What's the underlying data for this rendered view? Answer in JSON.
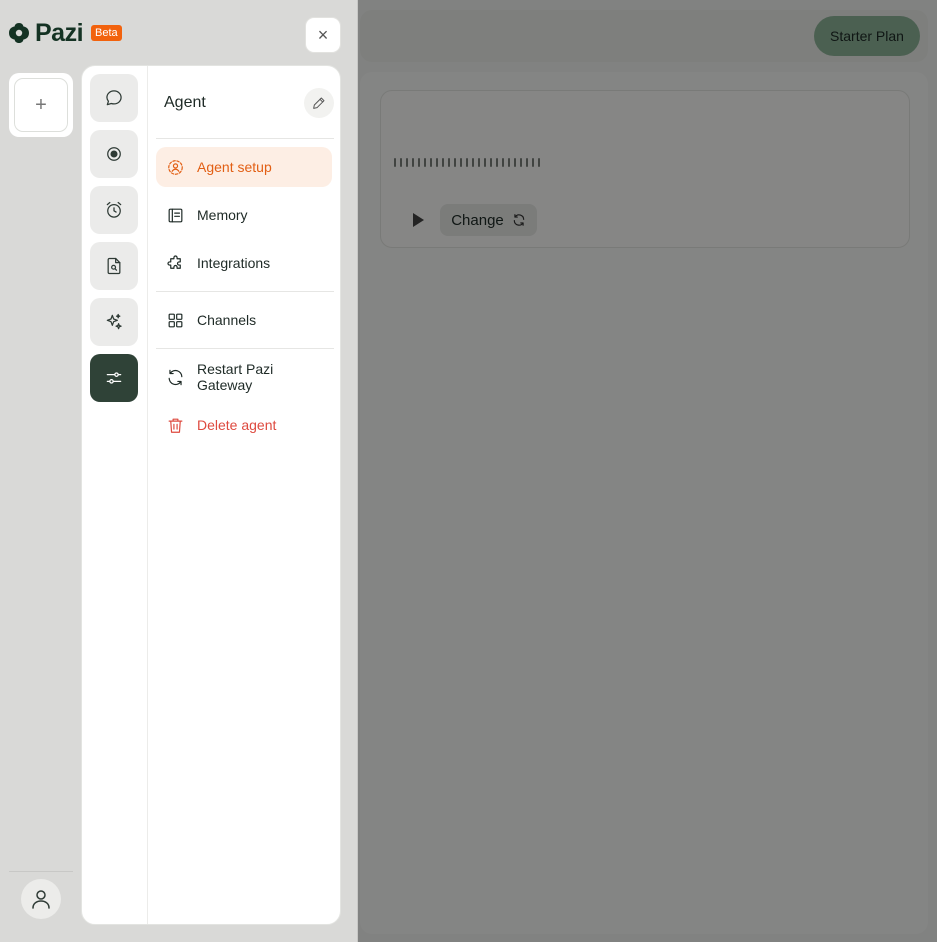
{
  "app": {
    "name": "Pazi",
    "badge": "Beta",
    "plan_label": "Starter Plan"
  },
  "close_label": "×",
  "new_label": "+",
  "background": {
    "change_label": "Change"
  },
  "rail": [
    {
      "name": "chat",
      "icon": "chat-bubble-icon",
      "active": false
    },
    {
      "name": "record",
      "icon": "record-icon",
      "active": false
    },
    {
      "name": "schedule",
      "icon": "alarm-clock-icon",
      "active": false
    },
    {
      "name": "documents",
      "icon": "document-search-icon",
      "active": false
    },
    {
      "name": "skills",
      "icon": "sparkles-icon",
      "active": false
    },
    {
      "name": "settings",
      "icon": "sliders-icon",
      "active": true
    }
  ],
  "menu": {
    "title": "Agent",
    "items": [
      {
        "label": "Agent setup",
        "icon": "agent-setup-icon",
        "active": true
      },
      {
        "label": "Memory",
        "icon": "memory-icon"
      },
      {
        "label": "Integrations",
        "icon": "puzzle-icon"
      },
      {
        "label": "Channels",
        "icon": "grid-icon"
      },
      {
        "label": "Restart Pazi Gateway",
        "icon": "refresh-icon"
      },
      {
        "label": "Delete agent",
        "icon": "trash-icon",
        "danger": true
      }
    ]
  },
  "colors": {
    "accent": "#e25f14",
    "brand_dark": "#2f4237",
    "danger": "#de4a3f",
    "beta_badge": "#f2620d",
    "plan_button": "#8fb59a"
  }
}
